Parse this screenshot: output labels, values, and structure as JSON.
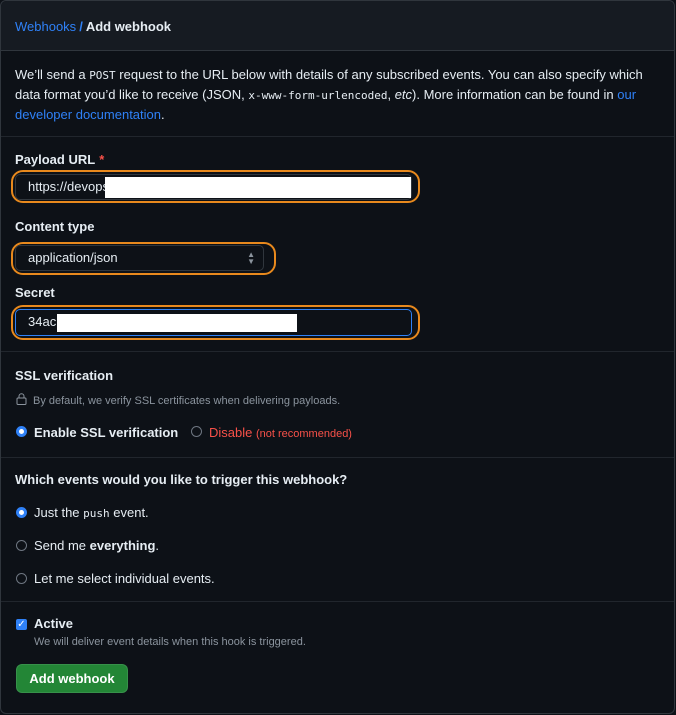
{
  "breadcrumb": {
    "parent": "Webhooks",
    "separator": "/",
    "current": "Add webhook"
  },
  "intro": {
    "t1": "We’ll send a ",
    "code1": "POST",
    "t2": " request to the URL below with details of any subscribed events. You can also specify which data format you’d like to receive (JSON, ",
    "code2": "x-www-form-urlencoded",
    "t3": ", ",
    "etc": "etc",
    "t4": "). More information can be found in ",
    "link": "our developer documentation",
    "t5": "."
  },
  "payload": {
    "label": "Payload URL",
    "required": "*",
    "value": "https://devops"
  },
  "content_type": {
    "label": "Content type",
    "value": "application/json"
  },
  "secret": {
    "label": "Secret",
    "value": "34ac"
  },
  "ssl": {
    "title": "SSL verification",
    "desc": "By default, we verify SSL certificates when delivering payloads.",
    "enable": "Enable SSL verification",
    "disable": "Disable",
    "not_recommended": "(not recommended)"
  },
  "events": {
    "question": "Which events would you like to trigger this webhook?",
    "opt1_pre": "Just the ",
    "opt1_code": "push",
    "opt1_post": " event.",
    "opt2_pre": "Send me ",
    "opt2_bold": "everything",
    "opt2_post": ".",
    "opt3": "Let me select individual events."
  },
  "active": {
    "label": "Active",
    "desc": "We will deliver event details when this hook is triggered."
  },
  "submit": "Add webhook",
  "colors": {
    "accent": "#2f81f7",
    "highlight": "#e8891d",
    "primary_button": "#238636",
    "danger": "#f85149"
  }
}
